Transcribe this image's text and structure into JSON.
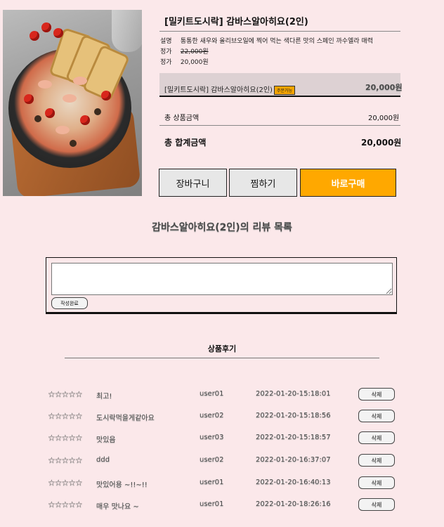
{
  "product": {
    "title": "[밀키트도시락] 감바스알아히요(2인)",
    "desc_label": "설명",
    "desc": "통통한 새우와 올리브오일에 찍어 먹는 색다른 맛의 스페인 까수엘라 매력",
    "orig_price_label": "정가",
    "orig_price": "22,000원",
    "price_label": "정가",
    "price": "20,000원"
  },
  "option": {
    "name": "[밀키트도시락] 감바스알아히요(2인)",
    "badge": "주문가능",
    "price": "20,000원"
  },
  "totals": {
    "product_total_label": "총 상품금액",
    "product_total": "20,000원",
    "grand_total_label": "총 합계금액",
    "grand_total": "20,000원"
  },
  "buttons": {
    "cart": "장바구니",
    "wish": "찜하기",
    "buy": "바로구매"
  },
  "review_heading": "감바스알아히요(2인)의 리뷰 목록",
  "review_form": {
    "placeholder": "",
    "submit": "작성완료"
  },
  "reviews_section_title": "상품후기",
  "reviews": [
    {
      "stars": "☆☆☆☆☆",
      "content": "최고!",
      "user": "user01",
      "date": "2022-01-20-15:18:01",
      "delete": "삭제"
    },
    {
      "stars": "☆☆☆☆☆",
      "content": "도시락먹을게같아요",
      "user": "user02",
      "date": "2022-01-20-15:18:56",
      "delete": "삭제"
    },
    {
      "stars": "☆☆☆☆☆",
      "content": "맛있음",
      "user": "user03",
      "date": "2022-01-20-15:18:57",
      "delete": "삭제"
    },
    {
      "stars": "☆☆☆☆☆",
      "content": "ddd",
      "user": "user02",
      "date": "2022-01-20-16:37:07",
      "delete": "삭제"
    },
    {
      "stars": "☆☆☆☆☆",
      "content": "맛있어용 ~!!~!!",
      "user": "user01",
      "date": "2022-01-20-16:40:13",
      "delete": "삭제"
    },
    {
      "stars": "☆☆☆☆☆",
      "content": "매우 맛나요 ~",
      "user": "user01",
      "date": "2022-01-20-18:26:16",
      "delete": "삭제"
    }
  ]
}
